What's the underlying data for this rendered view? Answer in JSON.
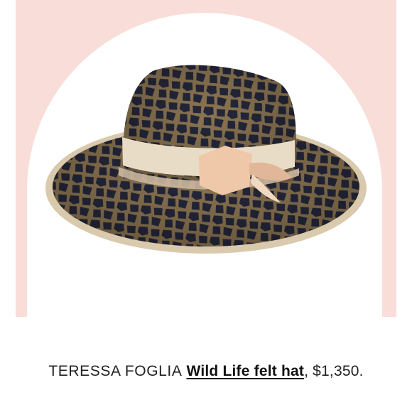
{
  "caption": {
    "brand": "TERESSA FOGLIA",
    "product": "Wild Life felt hat",
    "price": "$1,350."
  },
  "colors": {
    "panel_background": "#f8ddd8",
    "arch_background": "#ffffff",
    "hat_spots": "#24273a",
    "hat_base": "#8c7552",
    "ribbon": "#e8dcc6",
    "bow": "#efc8a9"
  },
  "image": {
    "subject": "hat-photo"
  }
}
